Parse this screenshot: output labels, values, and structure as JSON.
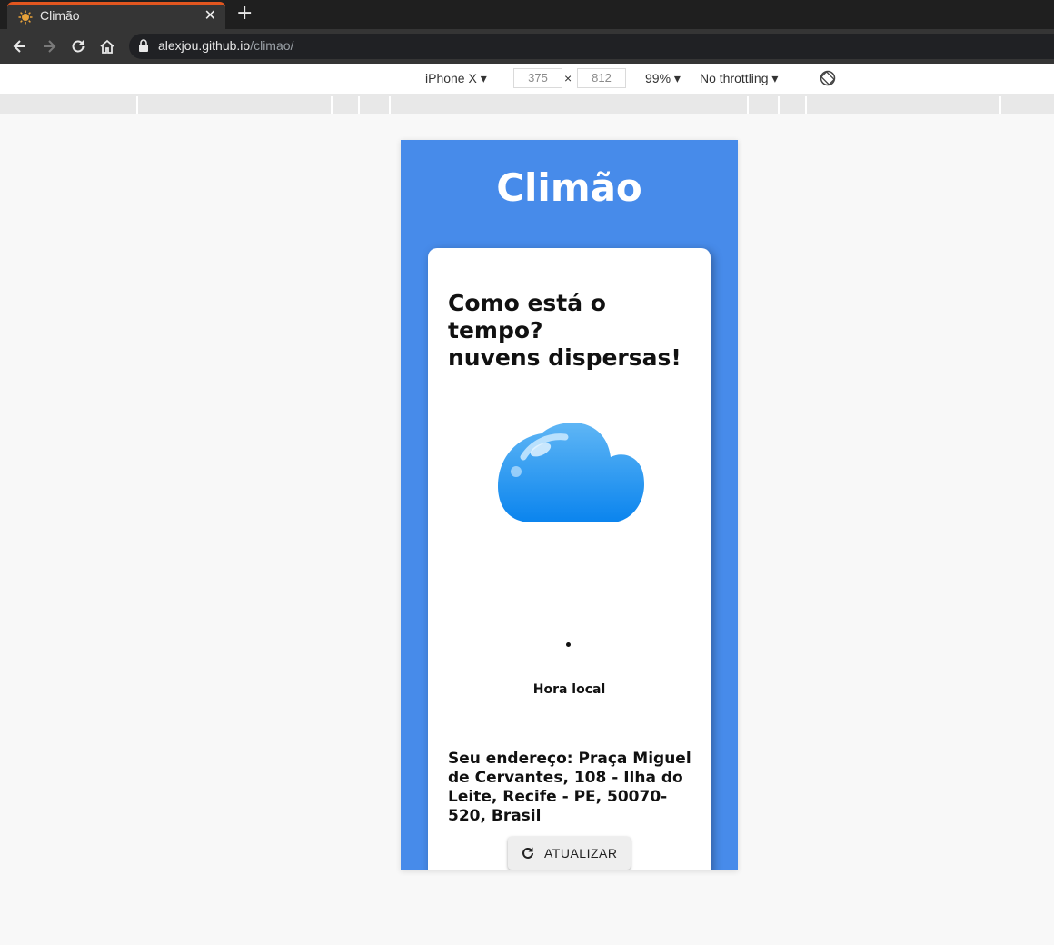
{
  "browser": {
    "tab_title": "Climão",
    "url_host": "alexjou.github.io",
    "url_path": "/climao/"
  },
  "devtools": {
    "device": "iPhone X",
    "width": "375",
    "height": "812",
    "zoom": "99%",
    "throttling": "No throttling",
    "times": "×"
  },
  "app": {
    "title": "Climão",
    "question": "Como está o tempo?",
    "condition": "nuvens dispersas!",
    "weather_icon": "cloud-icon",
    "time_label": "Hora local",
    "address": "Seu endereço: Praça Miguel de Cervantes, 108 - Ilha do Leite, Recife - PE, 50070-520, Brasil",
    "refresh_label": "ATUALIZAR",
    "accent": "#478bea"
  }
}
